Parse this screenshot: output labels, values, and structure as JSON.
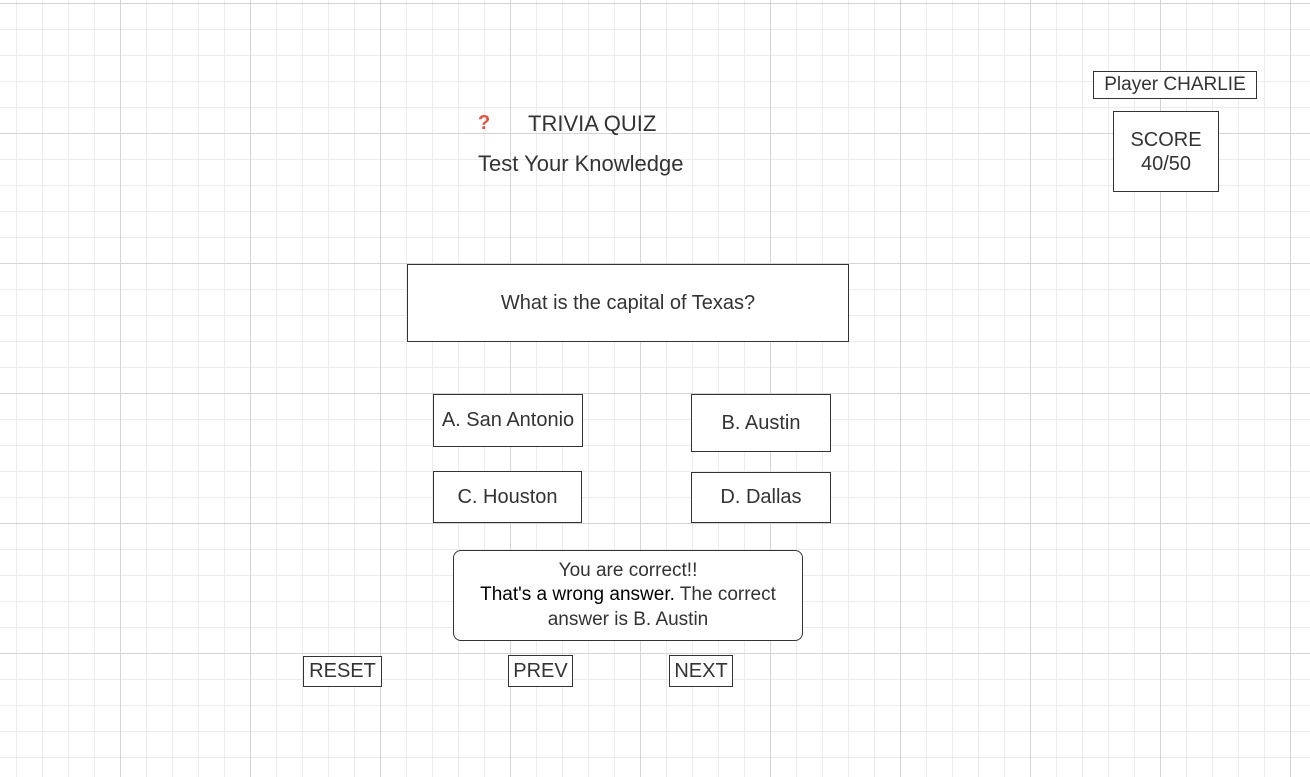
{
  "header": {
    "icon": "question-mark-icon",
    "icon_glyph": "?",
    "icon_color": "#e0533f",
    "title": "TRIVIA QUIZ",
    "subtitle": "Test Your Knowledge"
  },
  "player": {
    "label": "Player CHARLIE"
  },
  "score": {
    "label": "SCORE",
    "value": "40/50"
  },
  "question": {
    "text": "What is the capital of Texas?"
  },
  "answers": [
    {
      "label": "A. San Antonio"
    },
    {
      "label": "B. Austin"
    },
    {
      "label": "C. Houston"
    },
    {
      "label": "D. Dallas"
    }
  ],
  "feedback": {
    "correct_text": "You are correct!!",
    "wrong_lead": "That's a wrong answer.",
    "wrong_rest": " The correct answer is B. Austin"
  },
  "nav": {
    "reset_label": "RESET",
    "prev_label": "PREV",
    "next_label": "NEXT"
  }
}
